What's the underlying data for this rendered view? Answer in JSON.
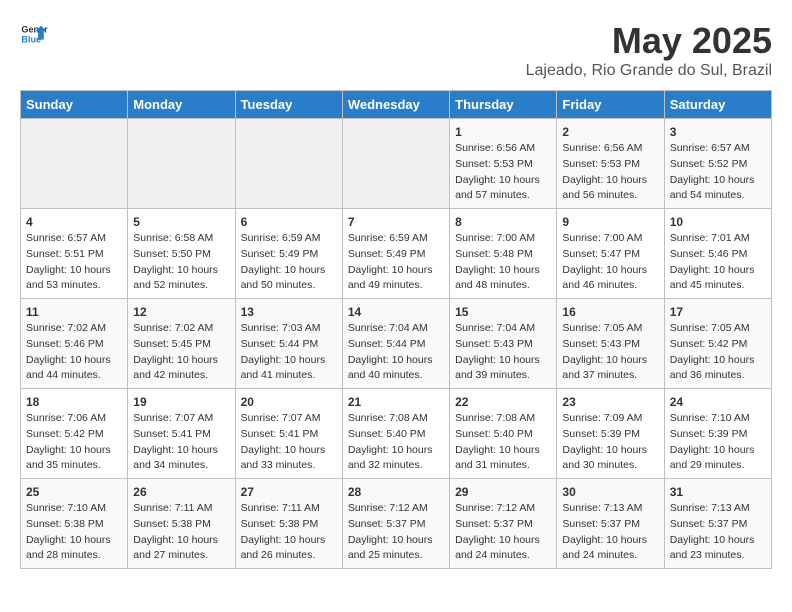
{
  "logo": {
    "line1": "General",
    "line2": "Blue"
  },
  "calendar": {
    "title": "May 2025",
    "subtitle": "Lajeado, Rio Grande do Sul, Brazil"
  },
  "headers": [
    "Sunday",
    "Monday",
    "Tuesday",
    "Wednesday",
    "Thursday",
    "Friday",
    "Saturday"
  ],
  "weeks": [
    [
      {
        "day": "",
        "lines": []
      },
      {
        "day": "",
        "lines": []
      },
      {
        "day": "",
        "lines": []
      },
      {
        "day": "",
        "lines": []
      },
      {
        "day": "1",
        "lines": [
          "Sunrise: 6:56 AM",
          "Sunset: 5:53 PM",
          "Daylight: 10 hours",
          "and 57 minutes."
        ]
      },
      {
        "day": "2",
        "lines": [
          "Sunrise: 6:56 AM",
          "Sunset: 5:53 PM",
          "Daylight: 10 hours",
          "and 56 minutes."
        ]
      },
      {
        "day": "3",
        "lines": [
          "Sunrise: 6:57 AM",
          "Sunset: 5:52 PM",
          "Daylight: 10 hours",
          "and 54 minutes."
        ]
      }
    ],
    [
      {
        "day": "4",
        "lines": [
          "Sunrise: 6:57 AM",
          "Sunset: 5:51 PM",
          "Daylight: 10 hours",
          "and 53 minutes."
        ]
      },
      {
        "day": "5",
        "lines": [
          "Sunrise: 6:58 AM",
          "Sunset: 5:50 PM",
          "Daylight: 10 hours",
          "and 52 minutes."
        ]
      },
      {
        "day": "6",
        "lines": [
          "Sunrise: 6:59 AM",
          "Sunset: 5:49 PM",
          "Daylight: 10 hours",
          "and 50 minutes."
        ]
      },
      {
        "day": "7",
        "lines": [
          "Sunrise: 6:59 AM",
          "Sunset: 5:49 PM",
          "Daylight: 10 hours",
          "and 49 minutes."
        ]
      },
      {
        "day": "8",
        "lines": [
          "Sunrise: 7:00 AM",
          "Sunset: 5:48 PM",
          "Daylight: 10 hours",
          "and 48 minutes."
        ]
      },
      {
        "day": "9",
        "lines": [
          "Sunrise: 7:00 AM",
          "Sunset: 5:47 PM",
          "Daylight: 10 hours",
          "and 46 minutes."
        ]
      },
      {
        "day": "10",
        "lines": [
          "Sunrise: 7:01 AM",
          "Sunset: 5:46 PM",
          "Daylight: 10 hours",
          "and 45 minutes."
        ]
      }
    ],
    [
      {
        "day": "11",
        "lines": [
          "Sunrise: 7:02 AM",
          "Sunset: 5:46 PM",
          "Daylight: 10 hours",
          "and 44 minutes."
        ]
      },
      {
        "day": "12",
        "lines": [
          "Sunrise: 7:02 AM",
          "Sunset: 5:45 PM",
          "Daylight: 10 hours",
          "and 42 minutes."
        ]
      },
      {
        "day": "13",
        "lines": [
          "Sunrise: 7:03 AM",
          "Sunset: 5:44 PM",
          "Daylight: 10 hours",
          "and 41 minutes."
        ]
      },
      {
        "day": "14",
        "lines": [
          "Sunrise: 7:04 AM",
          "Sunset: 5:44 PM",
          "Daylight: 10 hours",
          "and 40 minutes."
        ]
      },
      {
        "day": "15",
        "lines": [
          "Sunrise: 7:04 AM",
          "Sunset: 5:43 PM",
          "Daylight: 10 hours",
          "and 39 minutes."
        ]
      },
      {
        "day": "16",
        "lines": [
          "Sunrise: 7:05 AM",
          "Sunset: 5:43 PM",
          "Daylight: 10 hours",
          "and 37 minutes."
        ]
      },
      {
        "day": "17",
        "lines": [
          "Sunrise: 7:05 AM",
          "Sunset: 5:42 PM",
          "Daylight: 10 hours",
          "and 36 minutes."
        ]
      }
    ],
    [
      {
        "day": "18",
        "lines": [
          "Sunrise: 7:06 AM",
          "Sunset: 5:42 PM",
          "Daylight: 10 hours",
          "and 35 minutes."
        ]
      },
      {
        "day": "19",
        "lines": [
          "Sunrise: 7:07 AM",
          "Sunset: 5:41 PM",
          "Daylight: 10 hours",
          "and 34 minutes."
        ]
      },
      {
        "day": "20",
        "lines": [
          "Sunrise: 7:07 AM",
          "Sunset: 5:41 PM",
          "Daylight: 10 hours",
          "and 33 minutes."
        ]
      },
      {
        "day": "21",
        "lines": [
          "Sunrise: 7:08 AM",
          "Sunset: 5:40 PM",
          "Daylight: 10 hours",
          "and 32 minutes."
        ]
      },
      {
        "day": "22",
        "lines": [
          "Sunrise: 7:08 AM",
          "Sunset: 5:40 PM",
          "Daylight: 10 hours",
          "and 31 minutes."
        ]
      },
      {
        "day": "23",
        "lines": [
          "Sunrise: 7:09 AM",
          "Sunset: 5:39 PM",
          "Daylight: 10 hours",
          "and 30 minutes."
        ]
      },
      {
        "day": "24",
        "lines": [
          "Sunrise: 7:10 AM",
          "Sunset: 5:39 PM",
          "Daylight: 10 hours",
          "and 29 minutes."
        ]
      }
    ],
    [
      {
        "day": "25",
        "lines": [
          "Sunrise: 7:10 AM",
          "Sunset: 5:38 PM",
          "Daylight: 10 hours",
          "and 28 minutes."
        ]
      },
      {
        "day": "26",
        "lines": [
          "Sunrise: 7:11 AM",
          "Sunset: 5:38 PM",
          "Daylight: 10 hours",
          "and 27 minutes."
        ]
      },
      {
        "day": "27",
        "lines": [
          "Sunrise: 7:11 AM",
          "Sunset: 5:38 PM",
          "Daylight: 10 hours",
          "and 26 minutes."
        ]
      },
      {
        "day": "28",
        "lines": [
          "Sunrise: 7:12 AM",
          "Sunset: 5:37 PM",
          "Daylight: 10 hours",
          "and 25 minutes."
        ]
      },
      {
        "day": "29",
        "lines": [
          "Sunrise: 7:12 AM",
          "Sunset: 5:37 PM",
          "Daylight: 10 hours",
          "and 24 minutes."
        ]
      },
      {
        "day": "30",
        "lines": [
          "Sunrise: 7:13 AM",
          "Sunset: 5:37 PM",
          "Daylight: 10 hours",
          "and 24 minutes."
        ]
      },
      {
        "day": "31",
        "lines": [
          "Sunrise: 7:13 AM",
          "Sunset: 5:37 PM",
          "Daylight: 10 hours",
          "and 23 minutes."
        ]
      }
    ]
  ]
}
